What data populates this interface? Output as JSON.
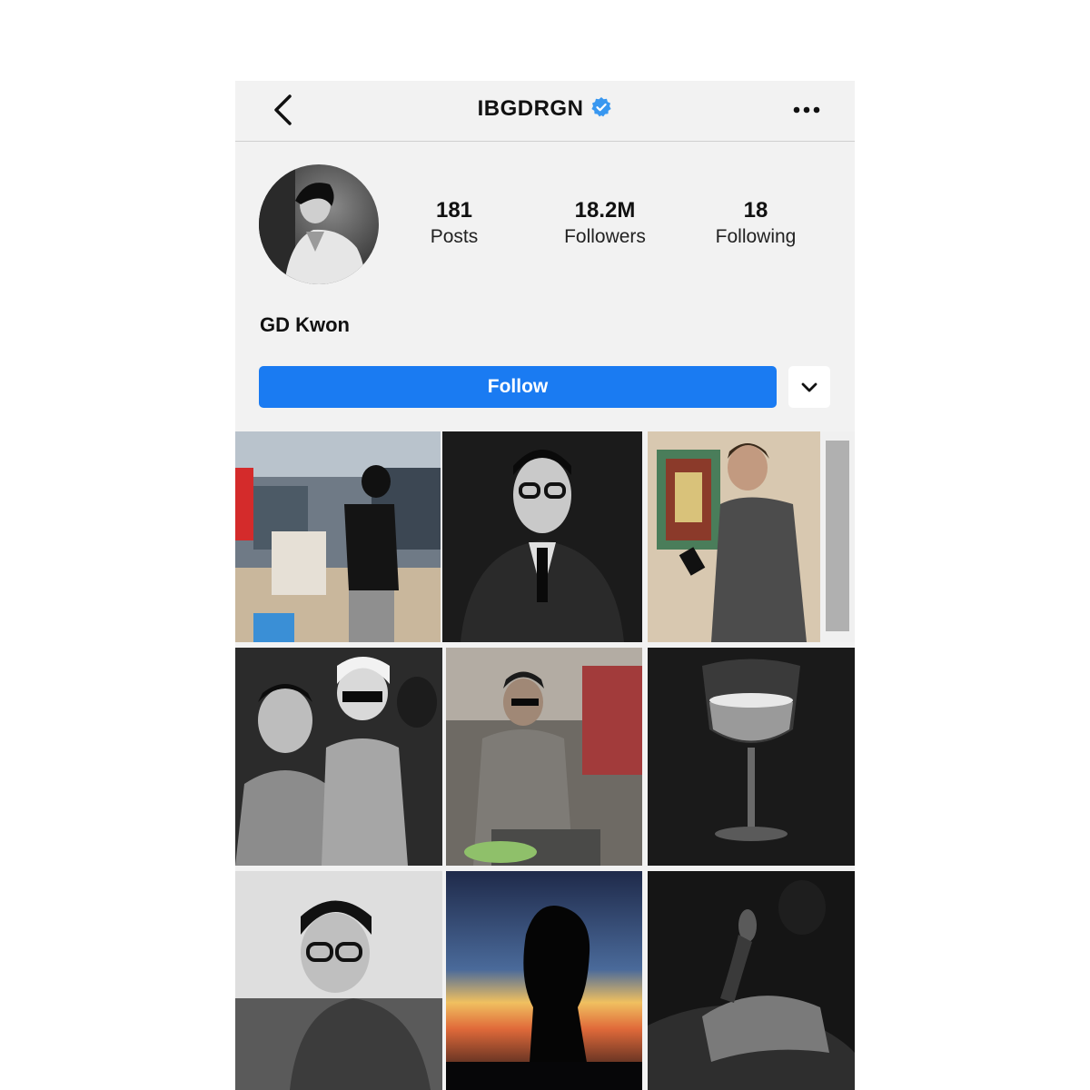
{
  "header": {
    "username": "IBGDRGN",
    "back_icon": "chevron-left-icon",
    "verified_icon": "verified-badge-icon",
    "more_icon": "more-horizontal-icon",
    "verified_color": "#3897f0"
  },
  "profile": {
    "display_name": "GD Kwon",
    "stats": [
      {
        "value": "181",
        "label": "Posts"
      },
      {
        "value": "18.2M",
        "label": "Followers"
      },
      {
        "value": "18",
        "label": "Following"
      }
    ]
  },
  "actions": {
    "follow_label": "Follow",
    "follow_color": "#1a7bf2",
    "dropdown_icon": "chevron-down-icon"
  },
  "posts": [
    {
      "description": "market-photo"
    },
    {
      "description": "portrait-glasses"
    },
    {
      "description": "phone-bookshelf"
    },
    {
      "description": "fashion-show-bw"
    },
    {
      "description": "seated-event"
    },
    {
      "description": "wine-glass"
    },
    {
      "description": "portrait-bw-glasses"
    },
    {
      "description": "sunset-silhouette"
    },
    {
      "description": "dark-lounge"
    }
  ]
}
